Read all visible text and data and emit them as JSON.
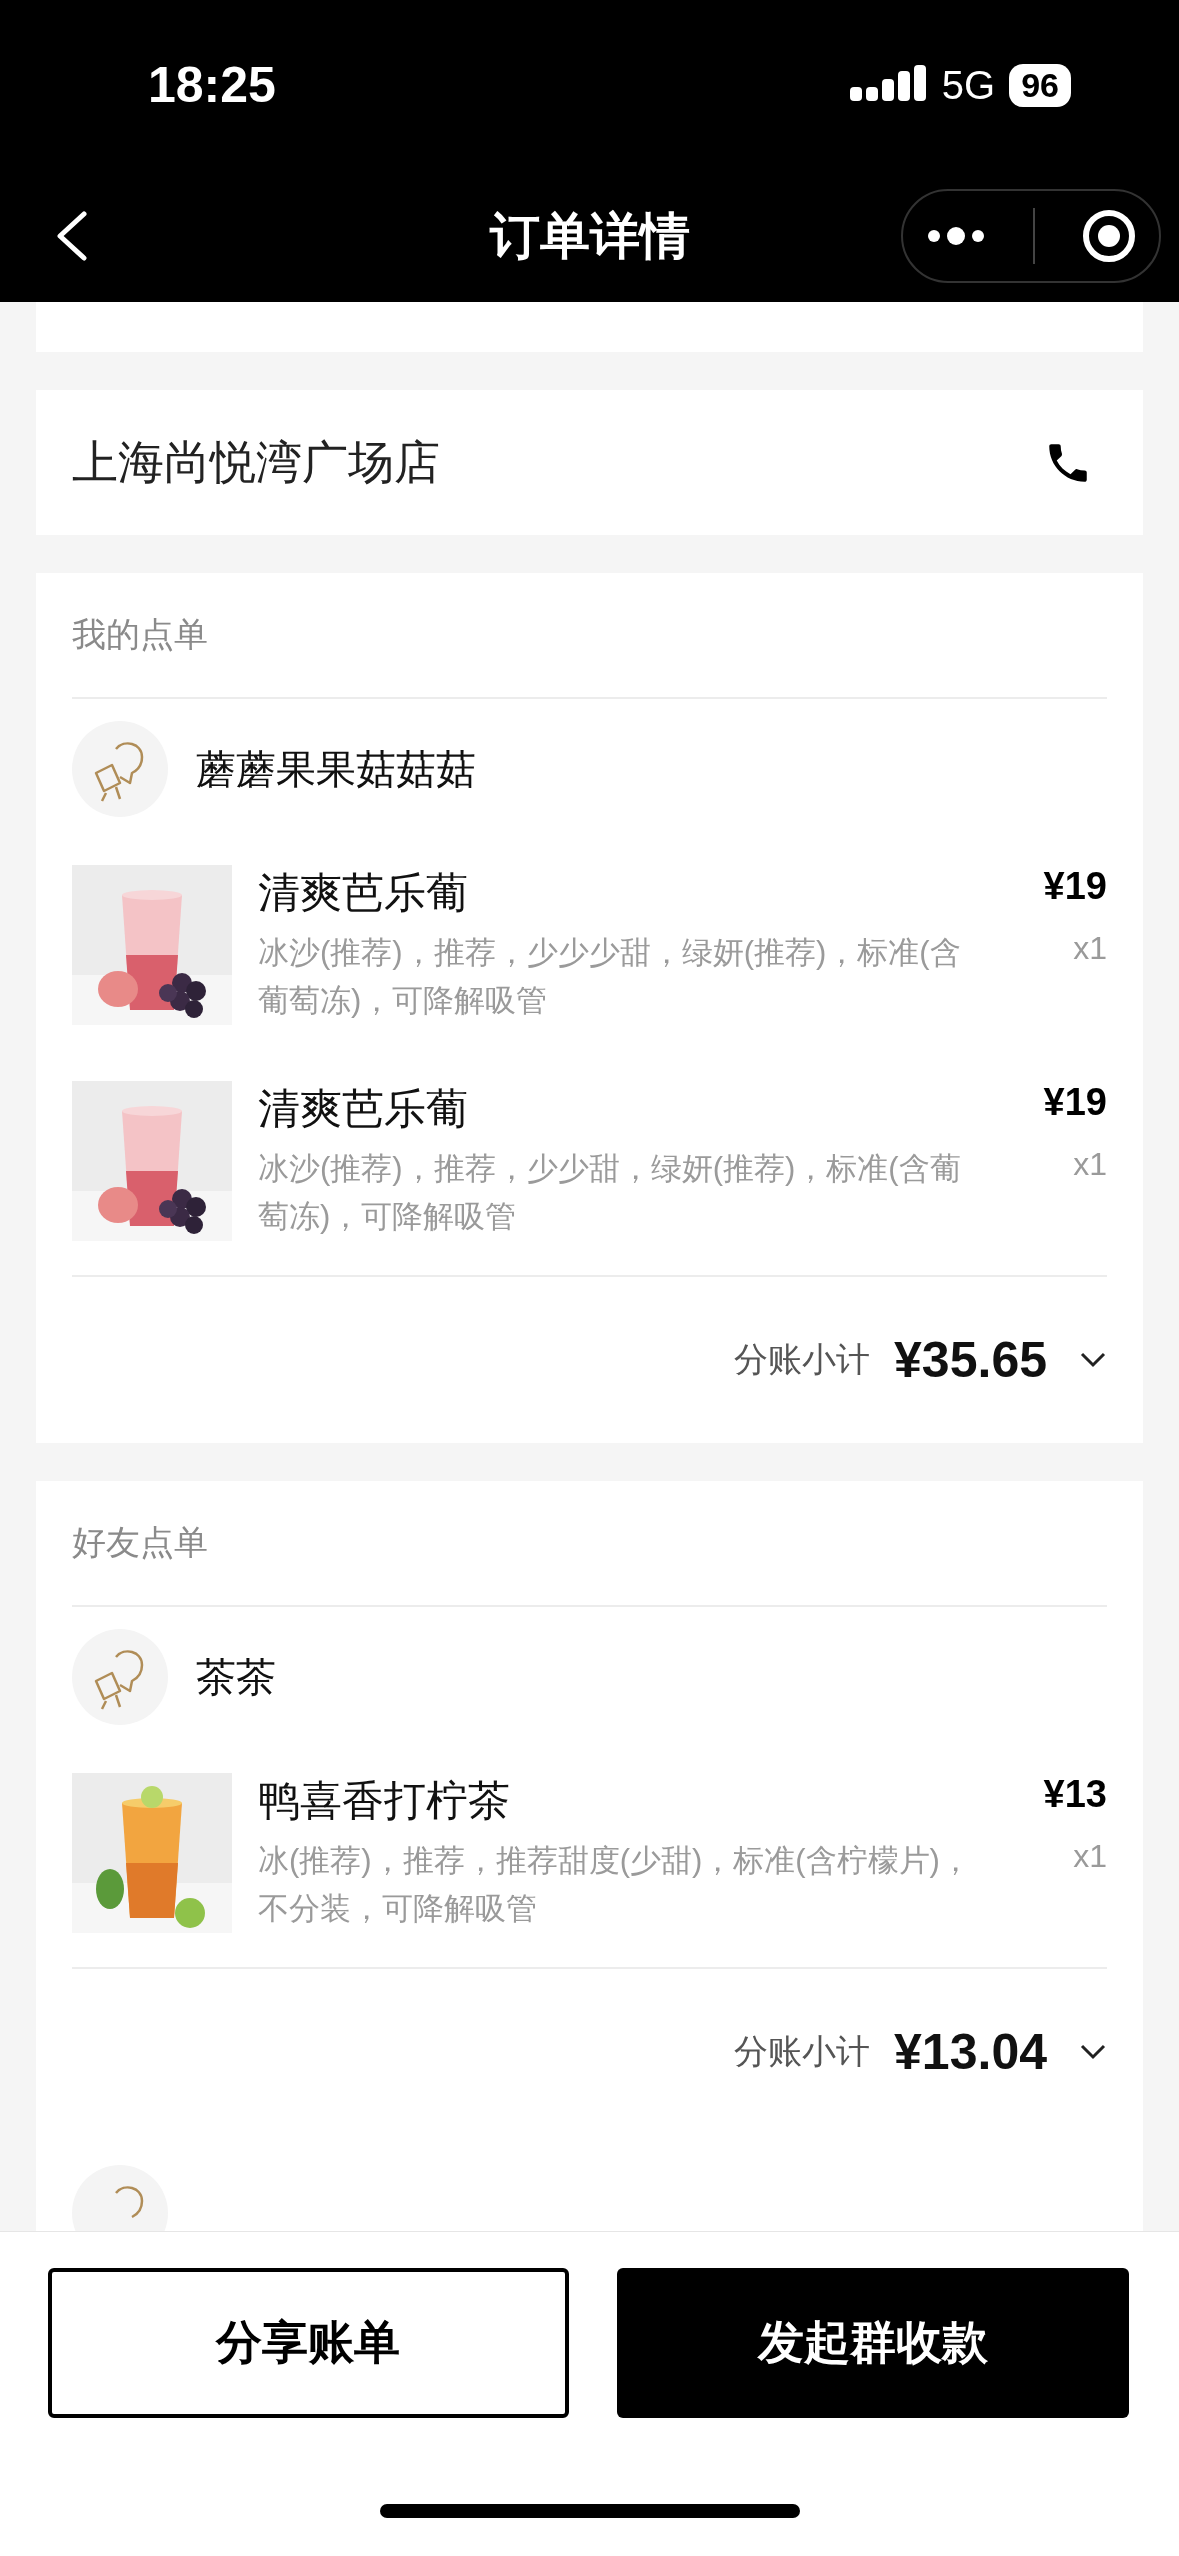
{
  "status_bar": {
    "time": "18:25",
    "network": "5G",
    "battery": "96"
  },
  "nav": {
    "title": "订单详情"
  },
  "store": {
    "name": "上海尚悦湾广场店"
  },
  "orders": [
    {
      "title": "我的点单",
      "user": "蘑蘑果果菇菇菇",
      "subtotal_label": "分账小计",
      "subtotal": "¥35.65",
      "items": [
        {
          "name": "清爽芭乐葡",
          "options": "冰沙(推荐)，推荐，少少少甜，绿妍(推荐)，标准(含葡萄冻)，可降解吸管",
          "price": "¥19",
          "qty": "x1"
        },
        {
          "name": "清爽芭乐葡",
          "options": "冰沙(推荐)，推荐，少少甜，绿妍(推荐)，标准(含葡萄冻)，可降解吸管",
          "price": "¥19",
          "qty": "x1"
        }
      ]
    },
    {
      "title": "好友点单",
      "user": "茶茶",
      "subtotal_label": "分账小计",
      "subtotal": "¥13.04",
      "items": [
        {
          "name": "鸭喜香打柠茶",
          "options": "冰(推荐)，推荐，推荐甜度(少甜)，标准(含柠檬片)，不分装，可降解吸管",
          "price": "¥13",
          "qty": "x1"
        }
      ]
    }
  ],
  "buttons": [
    {
      "label": "分享账单",
      "kind": "outline"
    },
    {
      "label": "发起群收款",
      "kind": "primary"
    }
  ]
}
